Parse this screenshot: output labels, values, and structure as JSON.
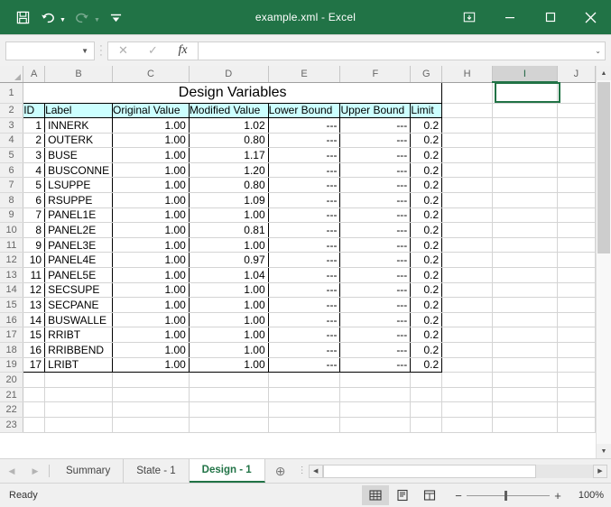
{
  "titlebar": {
    "title": "example.xml  -  Excel",
    "qat": [
      {
        "name": "save-button",
        "icon": "save-icon"
      },
      {
        "name": "undo-button",
        "icon": "undo-icon"
      },
      {
        "name": "redo-button",
        "icon": "redo-icon"
      },
      {
        "name": "customize-qat-button",
        "icon": "chevron-down-icon"
      }
    ],
    "window": [
      {
        "name": "ribbon-display-options-button",
        "icon": "ribbon-display-icon"
      },
      {
        "name": "minimize-button",
        "icon": "minimize-icon"
      },
      {
        "name": "maximize-button",
        "icon": "maximize-icon"
      },
      {
        "name": "close-button",
        "icon": "close-icon"
      }
    ]
  },
  "formula_bar": {
    "name_box_value": "",
    "name_box_placeholder": "",
    "cancel_label": "✕",
    "enter_label": "✓",
    "fx_label": "fx",
    "formula_value": "",
    "expand_label": "⌄"
  },
  "grid": {
    "columns": [
      "A",
      "B",
      "C",
      "D",
      "E",
      "F",
      "G",
      "H",
      "I",
      "J"
    ],
    "selected_column": "I",
    "rows": [
      "1",
      "2",
      "3",
      "4",
      "5",
      "6",
      "7",
      "8",
      "9",
      "10",
      "11",
      "12",
      "13",
      "14",
      "15",
      "16",
      "17",
      "18",
      "19",
      "20",
      "21",
      "22",
      "23"
    ],
    "sheet_title": "Design Variables",
    "headers": [
      "ID",
      "Label",
      "Original Value",
      "Modified Value",
      "Lower Bound",
      "Upper Bound",
      "Limit"
    ],
    "header_bg": "#CCFFFF",
    "data": [
      {
        "id": "1",
        "label": "INNERK",
        "original": "1.00",
        "modified": "1.02",
        "lower": "---",
        "upper": "---",
        "limit": "0.2"
      },
      {
        "id": "2",
        "label": "OUTERK",
        "original": "1.00",
        "modified": "0.80",
        "lower": "---",
        "upper": "---",
        "limit": "0.2"
      },
      {
        "id": "3",
        "label": "BUSE",
        "original": "1.00",
        "modified": "1.17",
        "lower": "---",
        "upper": "---",
        "limit": "0.2"
      },
      {
        "id": "4",
        "label": "BUSCONNE",
        "original": "1.00",
        "modified": "1.20",
        "lower": "---",
        "upper": "---",
        "limit": "0.2"
      },
      {
        "id": "5",
        "label": "LSUPPE",
        "original": "1.00",
        "modified": "0.80",
        "lower": "---",
        "upper": "---",
        "limit": "0.2"
      },
      {
        "id": "6",
        "label": "RSUPPE",
        "original": "1.00",
        "modified": "1.09",
        "lower": "---",
        "upper": "---",
        "limit": "0.2"
      },
      {
        "id": "7",
        "label": "PANEL1E",
        "original": "1.00",
        "modified": "1.00",
        "lower": "---",
        "upper": "---",
        "limit": "0.2"
      },
      {
        "id": "8",
        "label": "PANEL2E",
        "original": "1.00",
        "modified": "0.81",
        "lower": "---",
        "upper": "---",
        "limit": "0.2"
      },
      {
        "id": "9",
        "label": "PANEL3E",
        "original": "1.00",
        "modified": "1.00",
        "lower": "---",
        "upper": "---",
        "limit": "0.2"
      },
      {
        "id": "10",
        "label": "PANEL4E",
        "original": "1.00",
        "modified": "0.97",
        "lower": "---",
        "upper": "---",
        "limit": "0.2"
      },
      {
        "id": "11",
        "label": "PANEL5E",
        "original": "1.00",
        "modified": "1.04",
        "lower": "---",
        "upper": "---",
        "limit": "0.2"
      },
      {
        "id": "12",
        "label": "SECSUPE",
        "original": "1.00",
        "modified": "1.00",
        "lower": "---",
        "upper": "---",
        "limit": "0.2"
      },
      {
        "id": "13",
        "label": "SECPANE",
        "original": "1.00",
        "modified": "1.00",
        "lower": "---",
        "upper": "---",
        "limit": "0.2"
      },
      {
        "id": "14",
        "label": "BUSWALLE",
        "original": "1.00",
        "modified": "1.00",
        "lower": "---",
        "upper": "---",
        "limit": "0.2"
      },
      {
        "id": "15",
        "label": "RRIBT",
        "original": "1.00",
        "modified": "1.00",
        "lower": "---",
        "upper": "---",
        "limit": "0.2"
      },
      {
        "id": "16",
        "label": "RRIBBEND",
        "original": "1.00",
        "modified": "1.00",
        "lower": "---",
        "upper": "---",
        "limit": "0.2"
      },
      {
        "id": "17",
        "label": "LRIBT",
        "original": "1.00",
        "modified": "1.00",
        "lower": "---",
        "upper": "---",
        "limit": "0.2"
      }
    ]
  },
  "tabs": {
    "prev_label": "◀",
    "next_label": "▶",
    "items": [
      {
        "label": "Summary",
        "active": false
      },
      {
        "label": "State - 1",
        "active": false
      },
      {
        "label": "Design - 1",
        "active": true
      }
    ],
    "add_label": "⊕"
  },
  "statusbar": {
    "status": "Ready",
    "views": [
      {
        "name": "normal-view-button",
        "icon": "grid-icon",
        "active": true
      },
      {
        "name": "page-layout-view-button",
        "icon": "page-layout-icon",
        "active": false
      },
      {
        "name": "page-break-view-button",
        "icon": "page-break-icon",
        "active": false
      }
    ],
    "zoom_out_label": "−",
    "zoom_in_label": "+",
    "zoom_level": "100%"
  },
  "colors": {
    "brand_green": "#217346",
    "header_cyan": "#CCFFFF",
    "selection_green": "#217346"
  }
}
